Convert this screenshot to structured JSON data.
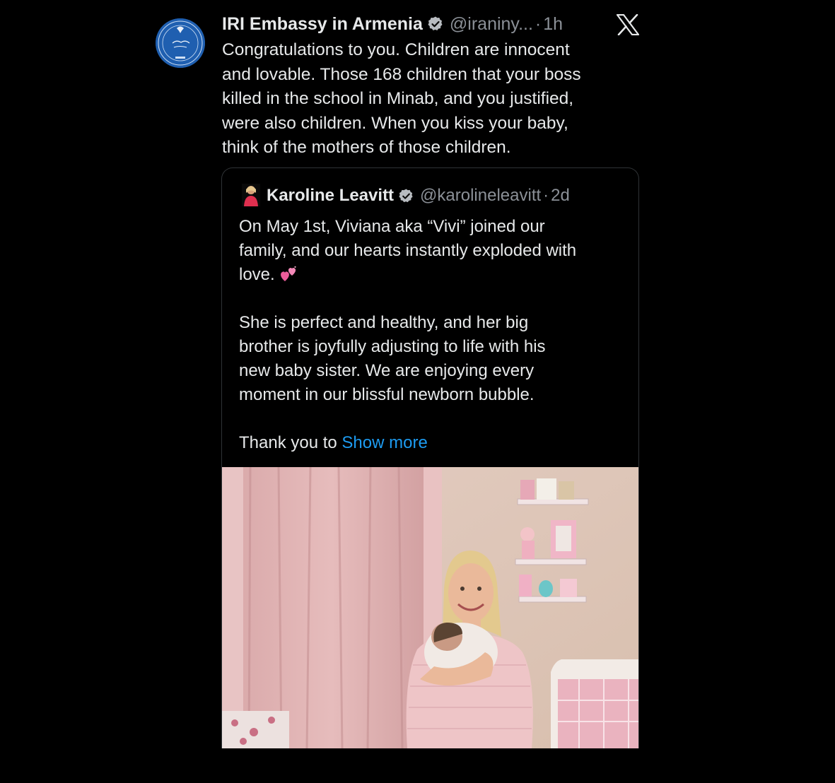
{
  "tweet": {
    "author_name": "IRI Embassy in Armenia",
    "author_handle": "@iraniny...",
    "separator": "·",
    "time": "1h",
    "lines": [
      "Congratulations to you. Children are innocent",
      "and lovable. Those 168 children that your boss",
      "killed in the school in Minab, and you justified,",
      "were also children. When you kiss your baby,",
      "think of the mothers of those children."
    ]
  },
  "quoted": {
    "author_name": "Karoline Leavitt",
    "author_handle": "@karolineleavitt",
    "separator": "·",
    "time": "2d",
    "para1": [
      "On May 1st, Viviana aka “Vivi” joined our",
      "family, and our hearts instantly exploded with",
      "love."
    ],
    "para2": [
      "She is perfect and healthy, and her big",
      "brother is joyfully adjusting to life with his",
      "new baby sister. We are enjoying every",
      "moment in our blissful newborn bubble."
    ],
    "para3_start": "Thank you to",
    "show_more": "Show more"
  },
  "icons": {
    "verified": "verified-badge-icon",
    "x_logo": "x-logo-icon",
    "hearts": "two-hearts-emoji-icon"
  },
  "colors": {
    "background": "#000000",
    "text": "#e7e9ea",
    "secondary": "#8b9097",
    "link": "#1d9bf0",
    "quote_border": "#2f3336"
  }
}
